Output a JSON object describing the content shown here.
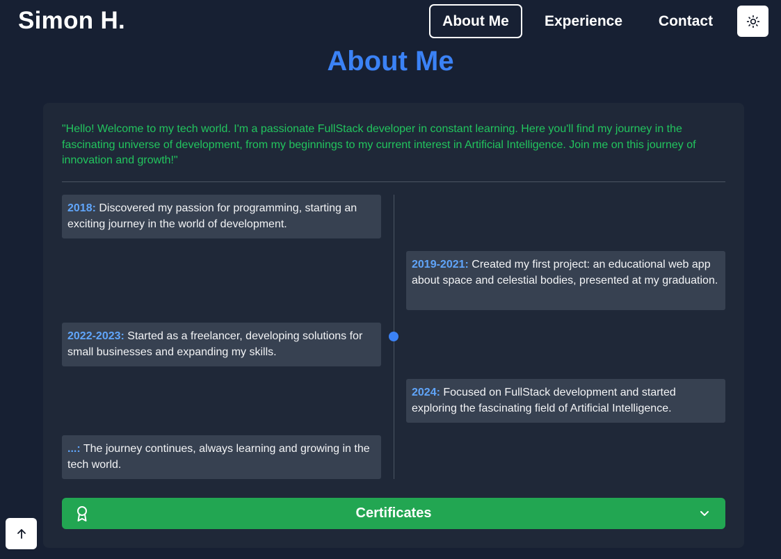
{
  "header": {
    "brand": "Simon H.",
    "nav": [
      {
        "label": "About Me",
        "active": true
      },
      {
        "label": "Experience",
        "active": false
      },
      {
        "label": "Contact",
        "active": false
      }
    ],
    "theme_toggle_icon": "sun-icon"
  },
  "about": {
    "title": "About Me",
    "intro": "\"Hello! Welcome to my tech world. I'm a passionate FullStack developer in constant learning. Here you'll find my journey in the fascinating universe of development, from my beginnings to my current interest in Artificial Intelligence. Join me on this journey of innovation and growth!\"",
    "timeline": [
      {
        "year": "2018:",
        "text": " Discovered my passion for programming, starting an exciting journey in the world of development.",
        "side": "left"
      },
      {
        "year": "2019-2021:",
        "text": " Created my first project: an educational web app about space and celestial bodies, presented at my graduation.",
        "side": "right"
      },
      {
        "year": "2022-2023:",
        "text": " Started as a freelancer, developing solutions for small businesses and expanding my skills.",
        "side": "left"
      },
      {
        "year": "2024:",
        "text": " Focused on FullStack development and started exploring the fascinating field of Artificial Intelligence.",
        "side": "right"
      },
      {
        "year": "...:",
        "text": " The journey continues, always learning and growing in the tech world.",
        "side": "left"
      }
    ],
    "certificates": {
      "label": "Certificates",
      "icon": "award-icon",
      "chevron": "chevron-down-icon"
    }
  },
  "scroll_top_icon": "arrow-up-icon",
  "colors": {
    "background": "#172033",
    "card": "#1f2838",
    "accent_blue": "#3b82f6",
    "accent_green": "#22c55e",
    "certificates_bg": "#22a652"
  }
}
